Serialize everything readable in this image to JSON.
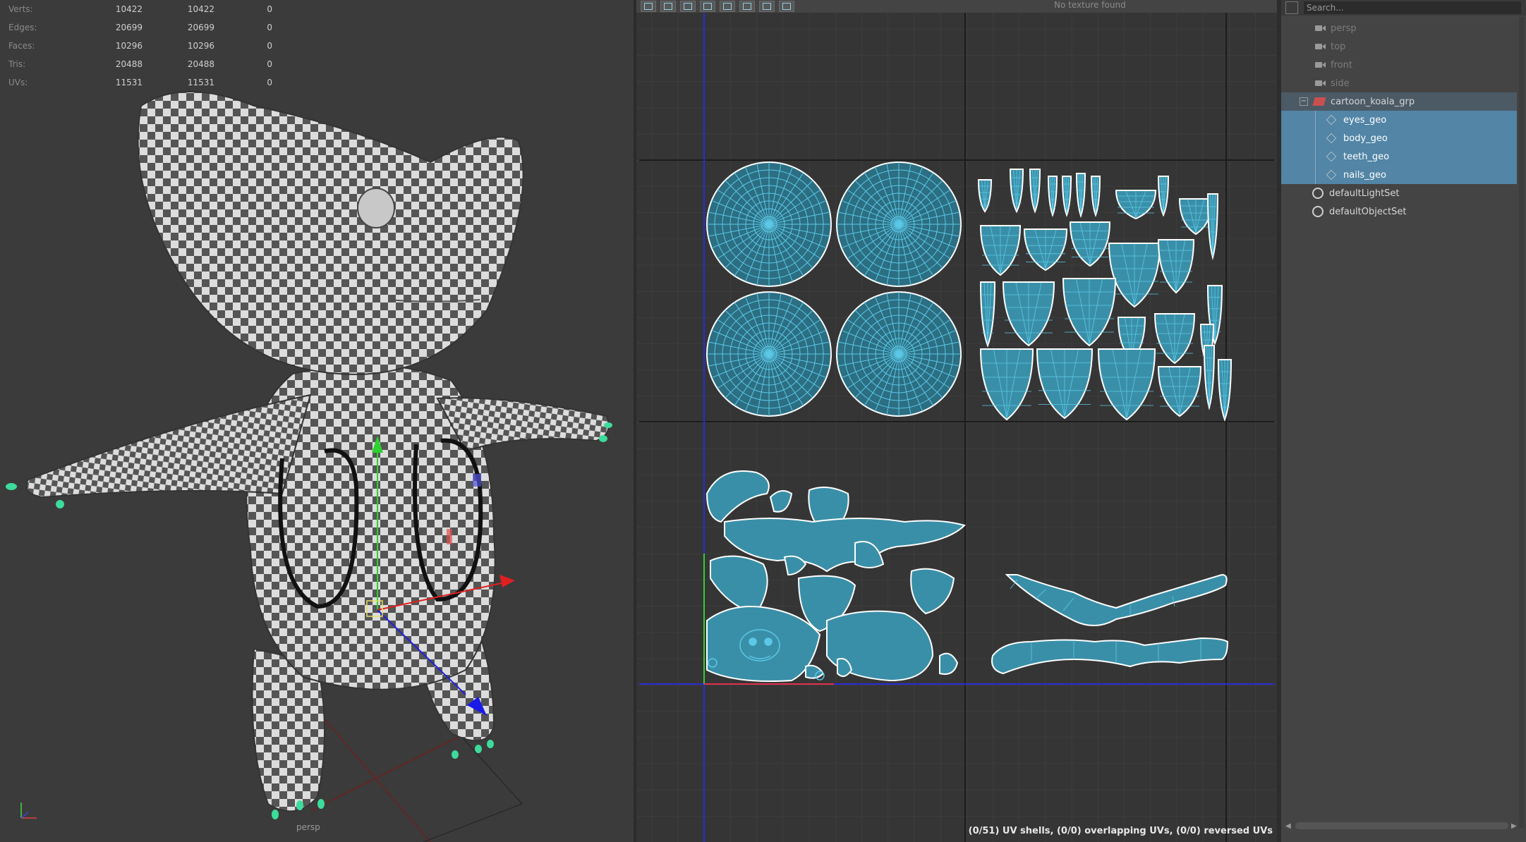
{
  "hud": {
    "rows": [
      {
        "label": "Verts:",
        "a": "10422",
        "b": "10422",
        "c": "0"
      },
      {
        "label": "Edges:",
        "a": "20699",
        "b": "20699",
        "c": "0"
      },
      {
        "label": "Faces:",
        "a": "10296",
        "b": "10296",
        "c": "0"
      },
      {
        "label": "Tris:",
        "a": "20488",
        "b": "20488",
        "c": "0"
      },
      {
        "label": "UVs:",
        "a": "11531",
        "b": "11531",
        "c": "0"
      }
    ]
  },
  "viewport": {
    "camera_label": "persp"
  },
  "uv_editor": {
    "texture_label": "No texture found",
    "status": "(0/51) UV shells, (0/0) overlapping UVs, (0/0) reversed UVs"
  },
  "outliner": {
    "search_placeholder": "Search...",
    "items": [
      {
        "label": "persp"
      },
      {
        "label": "top"
      },
      {
        "label": "front"
      },
      {
        "label": "side"
      },
      {
        "label": "cartoon_koala_grp"
      },
      {
        "label": "eyes_geo"
      },
      {
        "label": "body_geo"
      },
      {
        "label": "teeth_geo"
      },
      {
        "label": "nails_geo"
      },
      {
        "label": "defaultLightSet"
      },
      {
        "label": "defaultObjectSet"
      }
    ]
  },
  "colors": {
    "uv_shell": "#5bc8e6",
    "selection": "#5285a6",
    "checker_light": "#dcdcdc",
    "checker_dark": "#555555"
  }
}
